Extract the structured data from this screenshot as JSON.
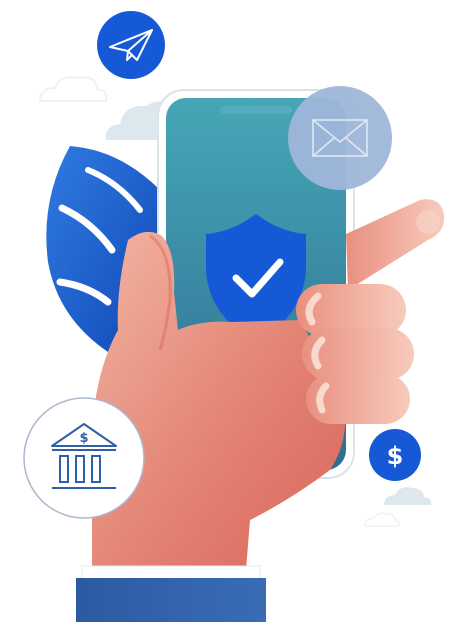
{
  "illustration": {
    "bank_badge": {
      "symbol": "$"
    },
    "coin_badge": {
      "symbol": "$"
    },
    "icons": [
      "paper-plane-icon",
      "envelope-icon",
      "shield-check-icon",
      "bank-icon",
      "dollar-icon",
      "cloud-icon",
      "leaf-icon"
    ],
    "colors": {
      "primary_blue": "#1559d6",
      "phone_teal": "#3f98b4",
      "phone_teal_dark": "#2f6f92",
      "skin": "#e58a7c",
      "skin_light": "#f6c7b8",
      "cloud": "#dbe6ee",
      "envelope_badge": "#9fb6d9",
      "cuff": "#2f5fa8"
    }
  }
}
